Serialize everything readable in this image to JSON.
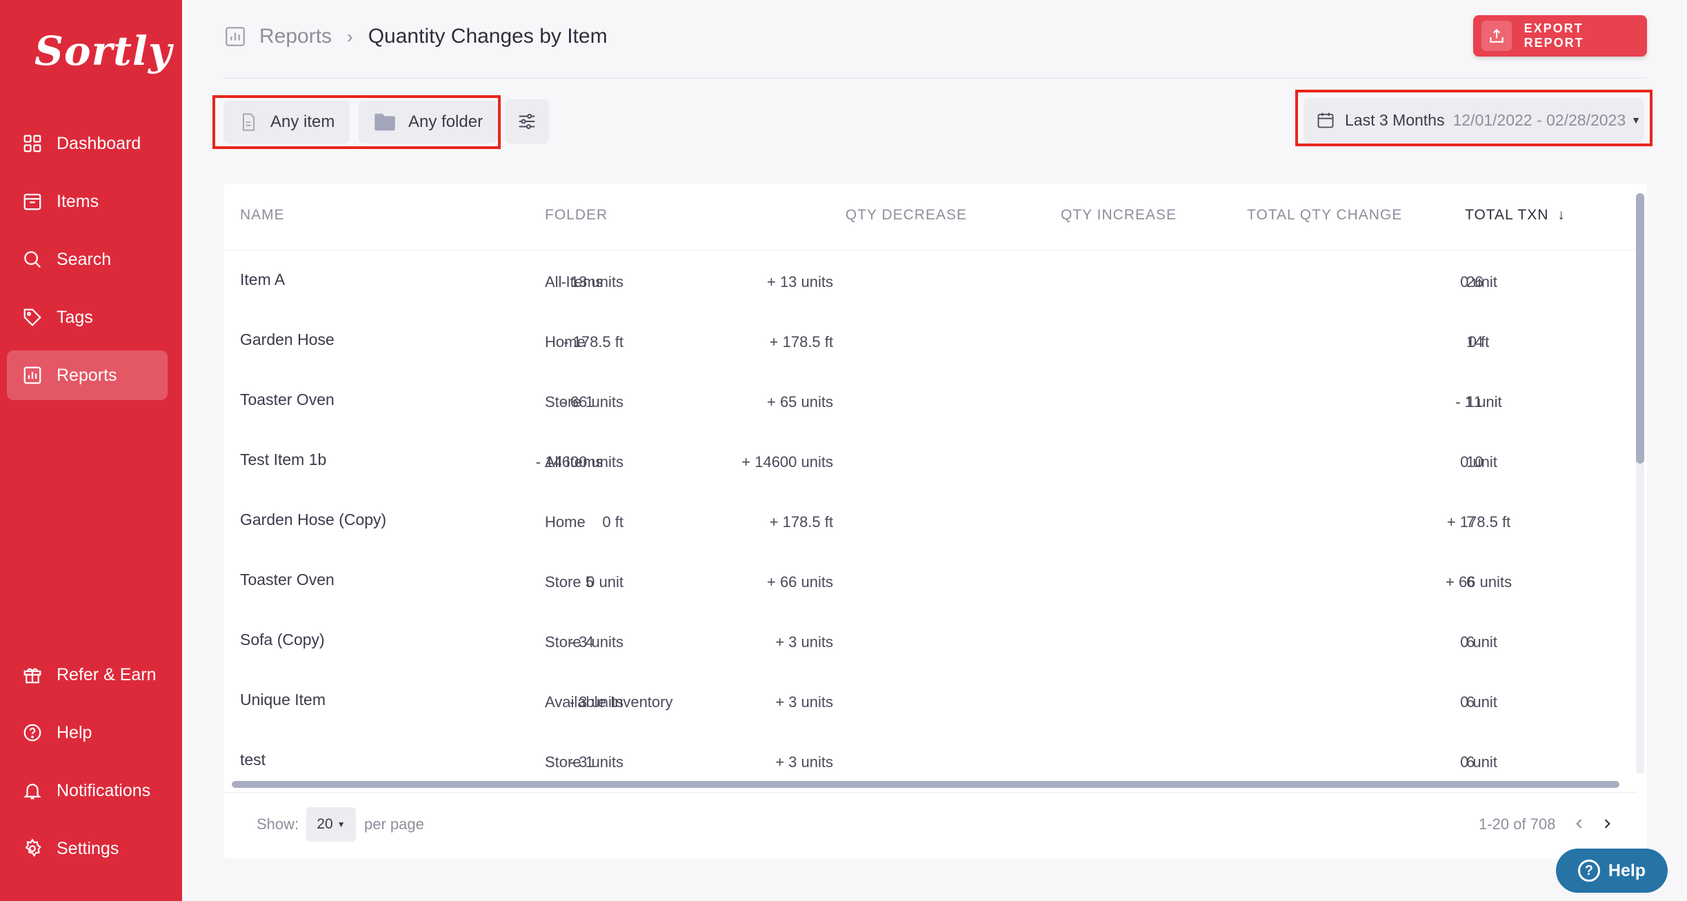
{
  "app": {
    "logo_text": "Sortly"
  },
  "sidebar": {
    "items": [
      {
        "label": "Dashboard",
        "icon": "dashboard-icon"
      },
      {
        "label": "Items",
        "icon": "items-icon"
      },
      {
        "label": "Search",
        "icon": "search-icon"
      },
      {
        "label": "Tags",
        "icon": "tag-icon"
      },
      {
        "label": "Reports",
        "icon": "reports-icon",
        "active": true
      }
    ],
    "bottom_items": [
      {
        "label": "Refer & Earn",
        "icon": "gift-icon"
      },
      {
        "label": "Help",
        "icon": "help-icon"
      },
      {
        "label": "Notifications",
        "icon": "bell-icon"
      },
      {
        "label": "Settings",
        "icon": "gear-icon"
      }
    ]
  },
  "header": {
    "breadcrumb_root": "Reports",
    "breadcrumb_separator": "›",
    "title": "Quantity Changes by Item",
    "export_label": "EXPORT REPORT"
  },
  "filters": {
    "item_label": "Any item",
    "folder_label": "Any folder",
    "date_preset": "Last 3 Months",
    "date_range": "12/01/2022 - 02/28/2023"
  },
  "table": {
    "columns": {
      "name": "NAME",
      "folder": "FOLDER",
      "qty_decrease": "QTY DECREASE",
      "qty_increase": "QTY INCREASE",
      "total_qty_change": "TOTAL QTY CHANGE",
      "total_txn": "TOTAL TXN"
    },
    "sort_indicator": "↓",
    "rows": [
      {
        "name": "Item A",
        "folder": "All Items",
        "dec": "- 13 units",
        "inc": "+ 13 units",
        "total": "0 unit",
        "txn": "26"
      },
      {
        "name": "Garden Hose",
        "folder": "Home",
        "dec": "- 178.5 ft",
        "inc": "+ 178.5 ft",
        "total": "0 ft",
        "txn": "14"
      },
      {
        "name": "Toaster Oven",
        "folder": "Store 1",
        "dec": "- 66 units",
        "inc": "+ 65 units",
        "total": "- 1 unit",
        "txn": "11"
      },
      {
        "name": "Test Item 1b",
        "folder": "All Items",
        "dec": "- 14600 units",
        "inc": "+ 14600 units",
        "total": "0 unit",
        "txn": "10"
      },
      {
        "name": "Garden Hose (Copy)",
        "folder": "Home",
        "dec": "0 ft",
        "inc": "+ 178.5 ft",
        "total": "+ 178.5 ft",
        "txn": "7"
      },
      {
        "name": "Toaster Oven",
        "folder": "Store 5",
        "dec": "0 unit",
        "inc": "+ 66 units",
        "total": "+ 66 units",
        "txn": "6"
      },
      {
        "name": "Sofa (Copy)",
        "folder": "Store 4",
        "dec": "- 3 units",
        "inc": "+ 3 units",
        "total": "0 unit",
        "txn": "6"
      },
      {
        "name": "Unique Item",
        "folder": "Available Inventory",
        "dec": "- 3 units",
        "inc": "+ 3 units",
        "total": "0 unit",
        "txn": "6"
      },
      {
        "name": "test",
        "folder": "Store 1",
        "dec": "- 3 units",
        "inc": "+ 3 units",
        "total": "0 unit",
        "txn": "6"
      }
    ]
  },
  "pagination": {
    "show_label": "Show:",
    "per_page_value": "20",
    "per_page_label": "per page",
    "range_text": "1-20 of 708"
  },
  "help_fab": {
    "label": "Help"
  },
  "colors": {
    "sidebar": "#dd2a3b",
    "export_button": "#e8424f",
    "highlight_box": "#e8261d",
    "help_button": "#2673a6"
  }
}
